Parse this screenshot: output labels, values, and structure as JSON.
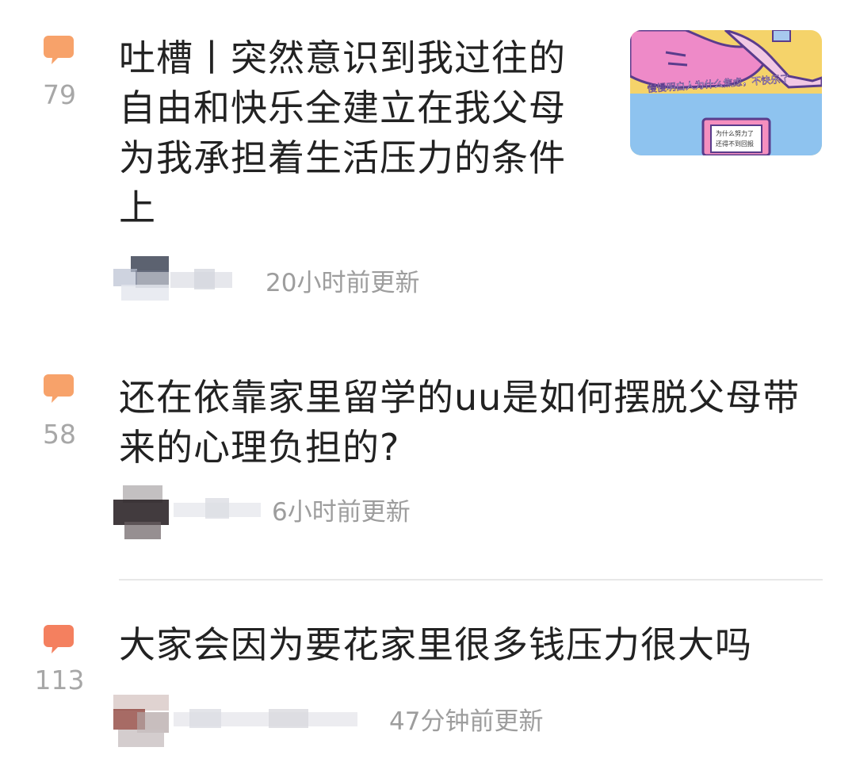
{
  "feed": {
    "posts": [
      {
        "count": "79",
        "title_lines": [
          "吐槽丨突然意识到我过往的",
          "自由和快乐全建立在我父母",
          "为我承担着生活压力的条件",
          "上"
        ],
        "time": "20小时前更新",
        "thumbnail": {
          "caption": "慢慢明白人为什么焦虑，不快乐了",
          "screen_lines": [
            "为什么努力了",
            "还得不到回报"
          ]
        }
      },
      {
        "count": "58",
        "title_lines": [
          "还在依靠家里留学的uu是如何摆脱父母带",
          "来的心理负担的?"
        ],
        "time": "6小时前更新"
      },
      {
        "count": "113",
        "title_lines": [
          "大家会因为要花家里很多钱压力很大吗"
        ],
        "time": "47分钟前更新"
      }
    ]
  },
  "colors": {
    "icon": "#f7a26a",
    "icon_hot": "#f4805f",
    "count": "#a7a7a7",
    "title": "#222222",
    "time": "#9d9d9d"
  },
  "icons": {
    "comment": "speech-bubble-icon"
  }
}
